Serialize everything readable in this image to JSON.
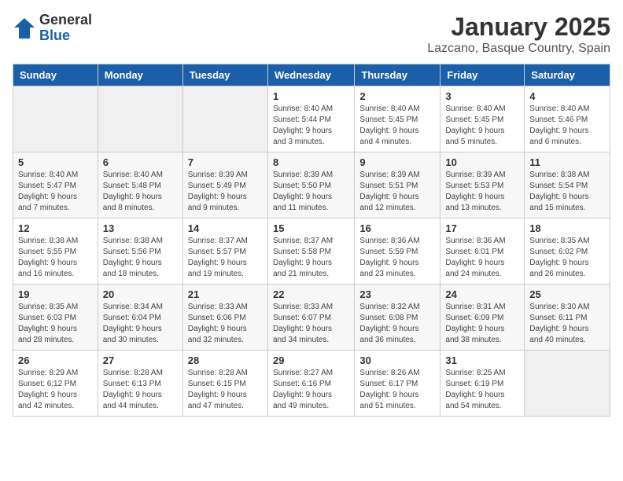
{
  "logo": {
    "general": "General",
    "blue": "Blue"
  },
  "title": "January 2025",
  "subtitle": "Lazcano, Basque Country, Spain",
  "headers": [
    "Sunday",
    "Monday",
    "Tuesday",
    "Wednesday",
    "Thursday",
    "Friday",
    "Saturday"
  ],
  "weeks": [
    [
      {
        "day": "",
        "info": ""
      },
      {
        "day": "",
        "info": ""
      },
      {
        "day": "",
        "info": ""
      },
      {
        "day": "1",
        "info": "Sunrise: 8:40 AM\nSunset: 5:44 PM\nDaylight: 9 hours\nand 3 minutes."
      },
      {
        "day": "2",
        "info": "Sunrise: 8:40 AM\nSunset: 5:45 PM\nDaylight: 9 hours\nand 4 minutes."
      },
      {
        "day": "3",
        "info": "Sunrise: 8:40 AM\nSunset: 5:45 PM\nDaylight: 9 hours\nand 5 minutes."
      },
      {
        "day": "4",
        "info": "Sunrise: 8:40 AM\nSunset: 5:46 PM\nDaylight: 9 hours\nand 6 minutes."
      }
    ],
    [
      {
        "day": "5",
        "info": "Sunrise: 8:40 AM\nSunset: 5:47 PM\nDaylight: 9 hours\nand 7 minutes."
      },
      {
        "day": "6",
        "info": "Sunrise: 8:40 AM\nSunset: 5:48 PM\nDaylight: 9 hours\nand 8 minutes."
      },
      {
        "day": "7",
        "info": "Sunrise: 8:39 AM\nSunset: 5:49 PM\nDaylight: 9 hours\nand 9 minutes."
      },
      {
        "day": "8",
        "info": "Sunrise: 8:39 AM\nSunset: 5:50 PM\nDaylight: 9 hours\nand 11 minutes."
      },
      {
        "day": "9",
        "info": "Sunrise: 8:39 AM\nSunset: 5:51 PM\nDaylight: 9 hours\nand 12 minutes."
      },
      {
        "day": "10",
        "info": "Sunrise: 8:39 AM\nSunset: 5:53 PM\nDaylight: 9 hours\nand 13 minutes."
      },
      {
        "day": "11",
        "info": "Sunrise: 8:38 AM\nSunset: 5:54 PM\nDaylight: 9 hours\nand 15 minutes."
      }
    ],
    [
      {
        "day": "12",
        "info": "Sunrise: 8:38 AM\nSunset: 5:55 PM\nDaylight: 9 hours\nand 16 minutes."
      },
      {
        "day": "13",
        "info": "Sunrise: 8:38 AM\nSunset: 5:56 PM\nDaylight: 9 hours\nand 18 minutes."
      },
      {
        "day": "14",
        "info": "Sunrise: 8:37 AM\nSunset: 5:57 PM\nDaylight: 9 hours\nand 19 minutes."
      },
      {
        "day": "15",
        "info": "Sunrise: 8:37 AM\nSunset: 5:58 PM\nDaylight: 9 hours\nand 21 minutes."
      },
      {
        "day": "16",
        "info": "Sunrise: 8:36 AM\nSunset: 5:59 PM\nDaylight: 9 hours\nand 23 minutes."
      },
      {
        "day": "17",
        "info": "Sunrise: 8:36 AM\nSunset: 6:01 PM\nDaylight: 9 hours\nand 24 minutes."
      },
      {
        "day": "18",
        "info": "Sunrise: 8:35 AM\nSunset: 6:02 PM\nDaylight: 9 hours\nand 26 minutes."
      }
    ],
    [
      {
        "day": "19",
        "info": "Sunrise: 8:35 AM\nSunset: 6:03 PM\nDaylight: 9 hours\nand 28 minutes."
      },
      {
        "day": "20",
        "info": "Sunrise: 8:34 AM\nSunset: 6:04 PM\nDaylight: 9 hours\nand 30 minutes."
      },
      {
        "day": "21",
        "info": "Sunrise: 8:33 AM\nSunset: 6:06 PM\nDaylight: 9 hours\nand 32 minutes."
      },
      {
        "day": "22",
        "info": "Sunrise: 8:33 AM\nSunset: 6:07 PM\nDaylight: 9 hours\nand 34 minutes."
      },
      {
        "day": "23",
        "info": "Sunrise: 8:32 AM\nSunset: 6:08 PM\nDaylight: 9 hours\nand 36 minutes."
      },
      {
        "day": "24",
        "info": "Sunrise: 8:31 AM\nSunset: 6:09 PM\nDaylight: 9 hours\nand 38 minutes."
      },
      {
        "day": "25",
        "info": "Sunrise: 8:30 AM\nSunset: 6:11 PM\nDaylight: 9 hours\nand 40 minutes."
      }
    ],
    [
      {
        "day": "26",
        "info": "Sunrise: 8:29 AM\nSunset: 6:12 PM\nDaylight: 9 hours\nand 42 minutes."
      },
      {
        "day": "27",
        "info": "Sunrise: 8:28 AM\nSunset: 6:13 PM\nDaylight: 9 hours\nand 44 minutes."
      },
      {
        "day": "28",
        "info": "Sunrise: 8:28 AM\nSunset: 6:15 PM\nDaylight: 9 hours\nand 47 minutes."
      },
      {
        "day": "29",
        "info": "Sunrise: 8:27 AM\nSunset: 6:16 PM\nDaylight: 9 hours\nand 49 minutes."
      },
      {
        "day": "30",
        "info": "Sunrise: 8:26 AM\nSunset: 6:17 PM\nDaylight: 9 hours\nand 51 minutes."
      },
      {
        "day": "31",
        "info": "Sunrise: 8:25 AM\nSunset: 6:19 PM\nDaylight: 9 hours\nand 54 minutes."
      },
      {
        "day": "",
        "info": ""
      }
    ]
  ]
}
